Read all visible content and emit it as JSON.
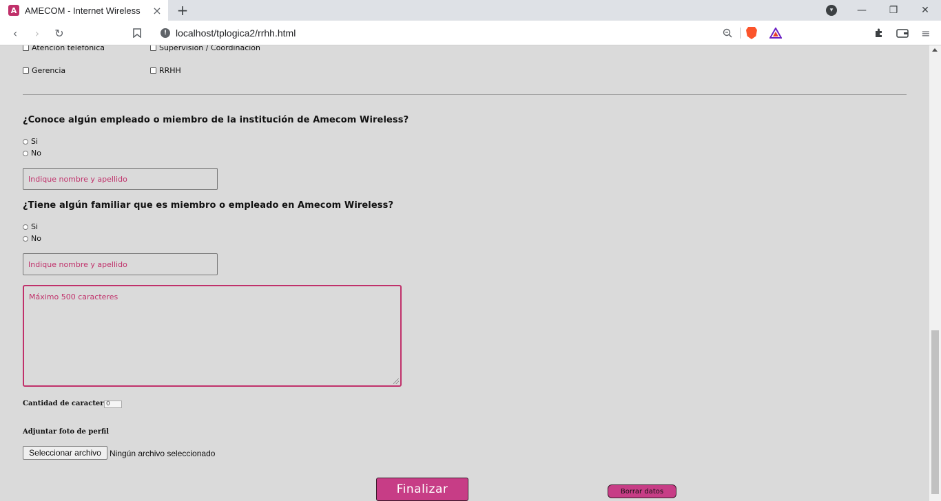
{
  "browser": {
    "tab_title": "AMECOM - Internet Wireless",
    "favicon_letter": "A",
    "url": "localhost/tplogica2/rrhh.html",
    "accent_color": "#c0306a"
  },
  "checkbox_section": {
    "items": [
      "Atención telefónica",
      "Supervisión / Coordinación",
      "Gerencia",
      "RRHH"
    ]
  },
  "question_employee": {
    "text": "¿Conoce algún empleado o miembro de la institución de Amecom Wireless?",
    "options": [
      "Si",
      "No"
    ],
    "input_placeholder": "Indique nombre y apellido"
  },
  "question_family": {
    "text": "¿Tiene algún familiar que es miembro o empleado en Amecom Wireless?",
    "options": [
      "Si",
      "No"
    ],
    "input_placeholder": "Indique nombre y apellido"
  },
  "comments": {
    "placeholder": "Máximo 500 caracteres"
  },
  "char_count": {
    "label": "Cantidad de caracteres:",
    "value": "0"
  },
  "photo": {
    "label": "Adjuntar foto de perfil",
    "button_label": "Seleccionar archivo",
    "status": "Ningún archivo seleccionado"
  },
  "actions": {
    "submit_label": "Finalizar",
    "reset_label": "Borrar datos",
    "button_color": "#c73d86"
  }
}
